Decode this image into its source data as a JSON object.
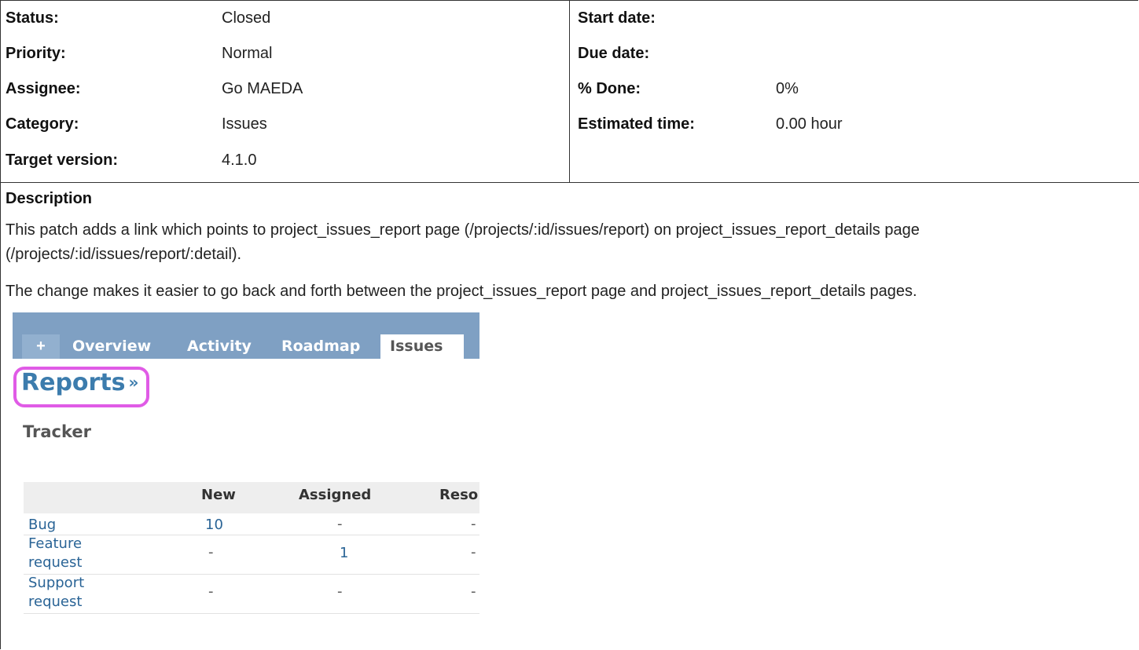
{
  "attributes": {
    "left": [
      {
        "label": "Status:",
        "value": "Closed"
      },
      {
        "label": "Priority:",
        "value": "Normal"
      },
      {
        "label": "Assignee:",
        "value": "Go MAEDA"
      },
      {
        "label": "Category:",
        "value": "Issues"
      },
      {
        "label": "Target version:",
        "value": "4.1.0"
      }
    ],
    "right": [
      {
        "label": "Start date:",
        "value": ""
      },
      {
        "label": "Due date:",
        "value": ""
      },
      {
        "label": "% Done:",
        "value": "0%"
      },
      {
        "label": "Estimated time:",
        "value": "0.00 hour"
      }
    ]
  },
  "description": {
    "title": "Description",
    "paragraph1_line1": "This patch adds a link which points to project_issues_report page (/projects/:id/issues/report) on project_issues_report_details page",
    "paragraph1_line2": "(/projects/:id/issues/report/:detail).",
    "paragraph2": "The change makes it easier to go back and forth between the project_issues_report page and project_issues_report_details pages."
  },
  "screenshot": {
    "tabs": {
      "plus": "+",
      "overview": "Overview",
      "activity": "Activity",
      "roadmap": "Roadmap",
      "issues": "Issues"
    },
    "reports_link": "Reports",
    "reports_raquo": "»",
    "section_title": "Tracker",
    "table": {
      "headers": {
        "new": "New",
        "assigned": "Assigned",
        "resolved": "Reso"
      },
      "rows": [
        {
          "tracker_line1": "Bug",
          "tracker_line2": "",
          "new": "10",
          "assigned": "-",
          "resolved": "-"
        },
        {
          "tracker_line1": "Feature",
          "tracker_line2": "request",
          "new": "-",
          "assigned": "1",
          "resolved": "-"
        },
        {
          "tracker_line1": "Support",
          "tracker_line2": "request",
          "new": "-",
          "assigned": "-",
          "resolved": "-"
        }
      ]
    },
    "colors": {
      "tab_bar": "#7fa0c3",
      "link": "#2a6496",
      "highlight": "#e05be6"
    }
  }
}
